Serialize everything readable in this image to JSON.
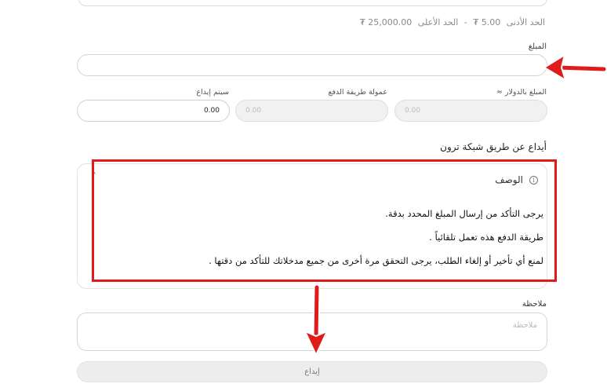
{
  "limits": {
    "min_label": "الحد الأدنى",
    "min_value": "5.00 ₮",
    "separator": "-",
    "max_label": "الحد الأعلى",
    "max_value": "25,000.00 ₮"
  },
  "amount": {
    "label": "المبلغ",
    "value": ""
  },
  "fields": {
    "usd_amount": {
      "label": "المبلغ بالدولار ≈",
      "value": "0.00"
    },
    "fee": {
      "label": "عمولة طريقة الدفع",
      "value": "0.00"
    },
    "deposit": {
      "label": "سيتم إيداع",
      "value": "0.00"
    }
  },
  "section_title": "أيداع عن طريق شبكة ترون",
  "description": {
    "title": "الوصف",
    "lines": [
      "يرجى التأكد من إرسال المبلغ المحدد بدقة.",
      "طريقة الدفع هذه تعمل تلقائياً .",
      "لمنع أي تأخير أو إلغاء الطلب، يرجى التحقق مرة أخرى من جميع مدخلاتك للتأكد من دقتها ."
    ]
  },
  "note": {
    "label": "ملاحظة",
    "placeholder": "ملاحظة"
  },
  "submit_label": "إيداع",
  "colors": {
    "annotation": "#e01b1b",
    "button_bg": "#ededed"
  }
}
